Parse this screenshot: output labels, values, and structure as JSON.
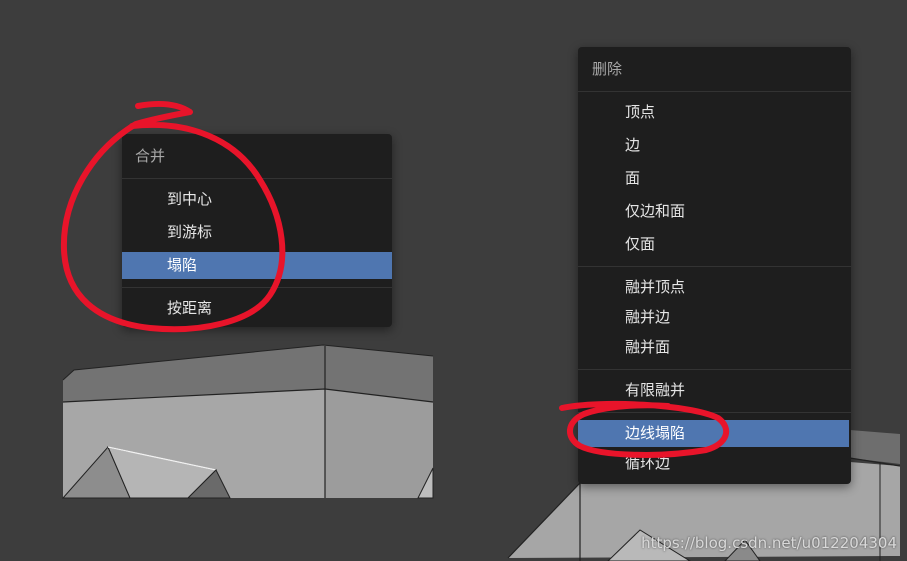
{
  "merge_menu": {
    "title": "合并",
    "items": [
      {
        "label": "到中心"
      },
      {
        "label": "到游标"
      },
      {
        "label": "塌陷"
      },
      {
        "label": "按距离"
      }
    ],
    "active_item": "塌陷"
  },
  "delete_menu": {
    "title": "删除",
    "items": [
      {
        "label": "顶点"
      },
      {
        "label": "边"
      },
      {
        "label": "面"
      },
      {
        "label": "仅边和面"
      },
      {
        "label": "仅面"
      },
      {
        "label": "融并顶点"
      },
      {
        "label": "融并边"
      },
      {
        "label": "融并面"
      },
      {
        "label": "有限融并"
      },
      {
        "label": "边线塌陷"
      },
      {
        "label": "循环边"
      }
    ],
    "active_item": "边线塌陷"
  },
  "watermark": "https://blog.csdn.net/u012204304",
  "colors": {
    "background": "#3d3d3d",
    "menu_bg": "#1e1e1e",
    "highlight": "#4f76b0",
    "annotation": "#e8142a",
    "mesh_light": "#a6a6a6",
    "mesh_top": "#6e6e6e"
  }
}
